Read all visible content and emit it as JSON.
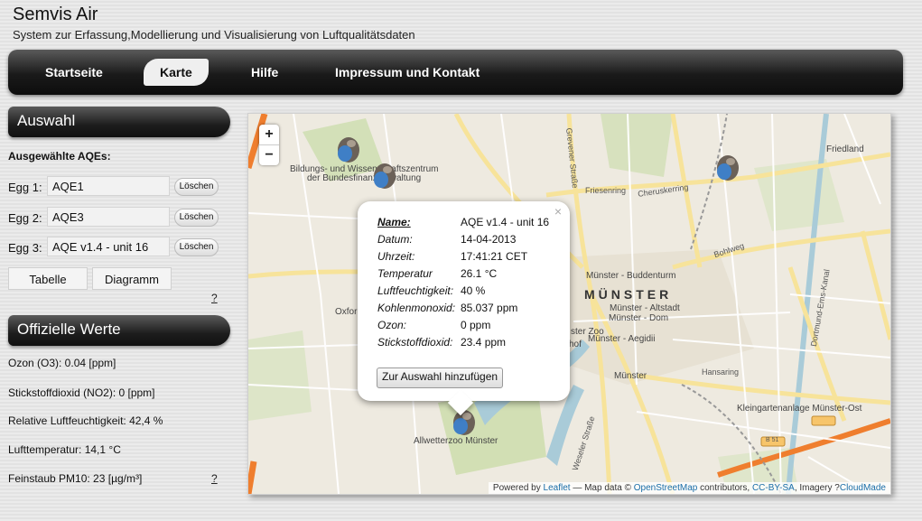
{
  "header": {
    "title": "Semvis Air",
    "subtitle": "System zur Erfassung,Modellierung und Visualisierung von Luftqualitätsdaten"
  },
  "nav": {
    "items": [
      "Startseite",
      "Karte",
      "Hilfe",
      "Impressum und Kontakt"
    ],
    "active": "Karte"
  },
  "auswahl": {
    "title": "Auswahl",
    "selected_label": "Ausgewählte AQEs:",
    "eggs": [
      {
        "label": "Egg 1:",
        "value": "AQE1",
        "delete_label": "Löschen"
      },
      {
        "label": "Egg 2:",
        "value": "AQE3",
        "delete_label": "Löschen"
      },
      {
        "label": "Egg 3:",
        "value": "AQE v1.4 - unit 16",
        "delete_label": "Löschen"
      }
    ],
    "table_button": "Tabelle",
    "diagram_button": "Diagramm",
    "help": "?"
  },
  "official": {
    "title": "Offizielle Werte",
    "values": [
      "Ozon (O3): 0.04 [ppm]",
      "Stickstoffdioxid (NO2): 0 [ppm]",
      "Relative Luftfeuchtigkeit: 42,4 %",
      "Lufttemperatur: 14,1 °C",
      "Feinstaub PM10: 23 [µg/m³]"
    ],
    "help": "?"
  },
  "map": {
    "zoom_in": "+",
    "zoom_out": "−",
    "labels": {
      "bildung1": "Bildungs- und Wissenschaftszentrum",
      "bildung2": "der Bundesfinanzverwaltung",
      "city": "MÜNSTER",
      "buddenturm": "Münster - Buddenturm",
      "altstadt": "Münster - Altstadt",
      "dom": "Münster - Dom",
      "aegidii": "Münster - Aegidii",
      "muenster": "Münster",
      "zoo": "Allwetterzoo Münster",
      "kleingarten": "Kleingartenanlage Münster-Ost",
      "hansaring": "Hansaring",
      "friesenring": "Friesenring",
      "cheruskerring": "Cheruskerring",
      "bohlweg": "Bohlweg",
      "friedland": "Friedland",
      "oxford": "Oxford",
      "hof": "hof",
      "zoo_short": "ster Zoo",
      "weseler": "Weseler Straße",
      "grevener": "Grevener Straße",
      "kanal": "Dortmund-Ems-Kanal",
      "b51": "B 51"
    },
    "popup": {
      "close": "×",
      "rows": [
        {
          "key": "Name:",
          "value": "AQE v1.4 - unit 16"
        },
        {
          "key": "Datum:",
          "value": "14-04-2013"
        },
        {
          "key": "Uhrzeit:",
          "value": "17:41:21 CET"
        },
        {
          "key": "Temperatur",
          "value": "26.1 °C"
        },
        {
          "key": "Luftfeuchtigkeit:",
          "value": "40 %"
        },
        {
          "key": "Kohlenmonoxid:",
          "value": "85.037 ppm"
        },
        {
          "key": "Ozon:",
          "value": "0 ppm"
        },
        {
          "key": "Stickstoffdioxid:",
          "value": "23.4 ppm"
        }
      ],
      "button": "Zur Auswahl hinzufügen"
    },
    "attribution": {
      "powered": "Powered by",
      "leaflet": "Leaflet",
      "mapdata": "— Map data ©",
      "osm": "OpenStreetMap",
      "contributors": "contributors,",
      "license": "CC-BY-SA",
      "imagery": ", Imagery ?",
      "cloudmade": "CloudMade"
    }
  },
  "colors": {
    "nav_dark": "#1a1a1a",
    "map_land": "#eeeae0",
    "water": "#a9cbd8",
    "park": "#c8dba6",
    "motorway": "#ef7e2e",
    "link": "#1a6ea8"
  }
}
